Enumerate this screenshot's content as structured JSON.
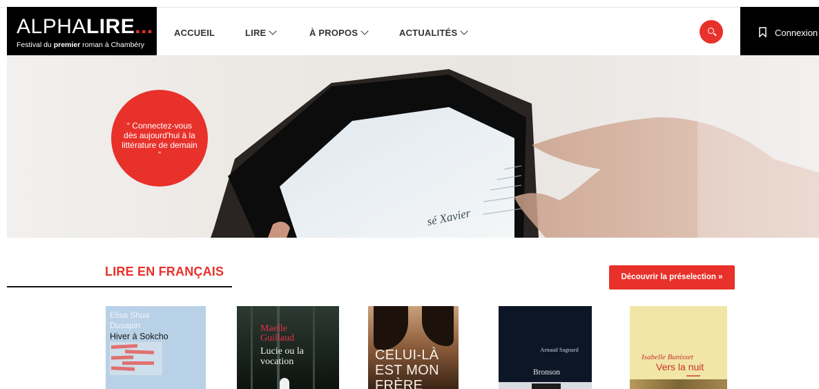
{
  "header": {
    "logo": {
      "word_light": "ALPHA",
      "word_bold": "LIRE",
      "dots": "...",
      "sub_prefix": "Festival du ",
      "sub_bold": "premier",
      "sub_suffix": " roman à Chambéry"
    },
    "nav": [
      {
        "label": "ACCUEIL"
      },
      {
        "label": "LIRE"
      },
      {
        "label": "À PROPOS"
      },
      {
        "label": "ACTUALITÉS"
      }
    ],
    "connexion": "Connexion"
  },
  "hero": {
    "quote": "“ Connectez-vous dès aujourd'hui à la littérature de demain ”",
    "screen_text": "sé Xavier"
  },
  "section": {
    "title": "LIRE EN FRANÇAIS",
    "cta": "Découvrir la préselection »"
  },
  "books": [
    {
      "author": "Elisa Shua Dusapin",
      "title": "Hiver à Sokcho"
    },
    {
      "author": "Maelle Guillaud",
      "title": "Lucie ou la vocation"
    },
    {
      "title": "CELUI-LÀ EST MON FRÈRE"
    },
    {
      "author": "Arnaud Sagnard",
      "title": "Bronson"
    },
    {
      "author": "Isabelle Bunisset",
      "title": "Vers la nuit"
    }
  ],
  "colors": {
    "accent": "#e8312b",
    "dark": "#000000"
  }
}
